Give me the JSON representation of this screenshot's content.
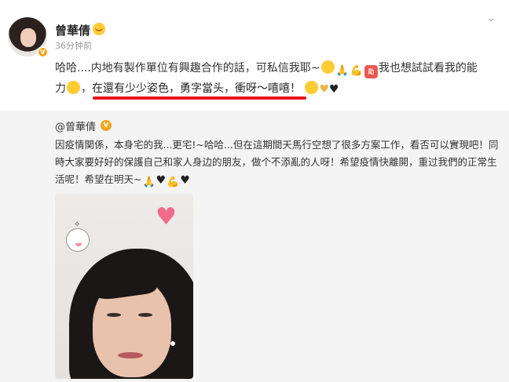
{
  "post": {
    "username": "曾華倩",
    "time": "36分钟前",
    "line1": "哈哈....内地有製作單位有興趣合作的話，可私信我耶~",
    "line1_tail": "我也想試試看我的能",
    "line2_prefix": "力",
    "line2_highlight": "在還有少少姿色，勇字當头，衝呀～嘻嘻！",
    "badge_text": "勵"
  },
  "repost": {
    "username": "@曾華倩",
    "line1": "因疫情関係，本身宅的我...更宅!~哈哈...但在這期間天馬行空想了很多方案工作，看否可以實現吧！同",
    "line2": "時大家要好好的保護自己和家人身边的朋友，做个不添亂的人呀！希望疫情快離開，重过我們的正常生",
    "line3": "活呢！希望在明天~"
  },
  "icons": {
    "chevron": "chevron-down-icon",
    "verified": "verified-badge-icon"
  },
  "colors": {
    "highlight_underline": "#e8141a",
    "verified": "#f5a623",
    "repost_bg": "#f4f4f4"
  }
}
